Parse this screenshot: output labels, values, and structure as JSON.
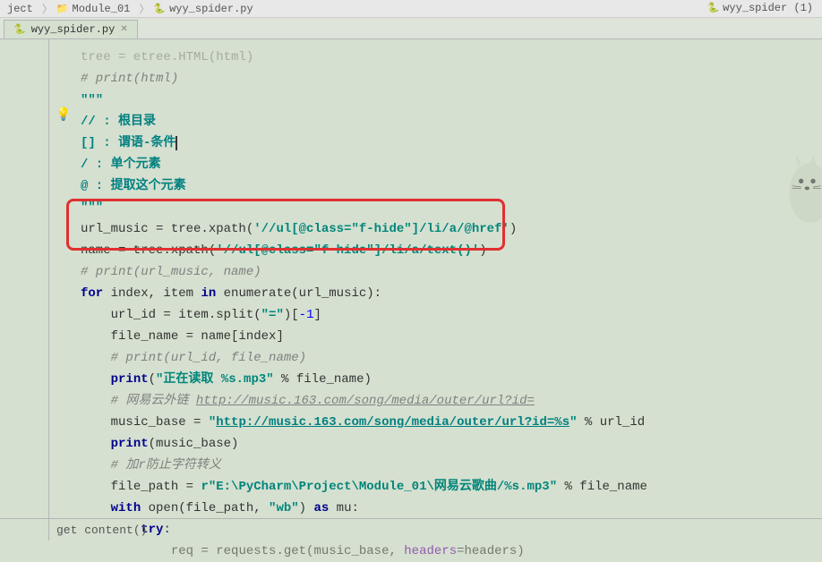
{
  "breadcrumb": {
    "items": [
      {
        "label": "ject"
      },
      {
        "label": "Module_01"
      },
      {
        "label": "wyy_spider.py"
      }
    ]
  },
  "run_config": "wyy_spider (1)",
  "tab": {
    "label": "wyy_spider.py"
  },
  "code": {
    "l1": "tree = etree.HTML(html)",
    "l2": "# print(html)",
    "l3": "\"\"\"",
    "l4": "// : 根目录",
    "l5": "[] : 谓语-条件",
    "l6": "/ : 单个元素",
    "l7": "@ : 提取这个元素",
    "l8": "\"\"\"",
    "l9a": "url_music = tree.xpath(",
    "l9b": "'//ul[@class=\"f-hide\"]/li/a/@href'",
    "l9c": ")",
    "l10a": "name = tree.xpath(",
    "l10b": "'//ul[@class=\"f-hide\"]/li/a/text()'",
    "l10c": ")",
    "l11": "# print(url_music, name)",
    "l12a": "for",
    "l12b": " index, item ",
    "l12c": "in",
    "l12d": " enumerate(url_music):",
    "l13a": "url_id = item.split(",
    "l13b": "\"=\"",
    "l13c": ")[",
    "l13d": "-1",
    "l13e": "]",
    "l14": "file_name = name[index]",
    "l15": "# print(url_id, file_name)",
    "l16a": "print",
    "l16b": "(",
    "l16c": "\"正在读取 %s.mp3\"",
    "l16d": " % file_name)",
    "l17a": "# 网易云外链 ",
    "l17b": "http://music.163.com/song/media/outer/url?id=",
    "l18a": "music_base = ",
    "l18b": "\"",
    "l18c": "http://music.163.com/song/media/outer/url?id=%s",
    "l18d": "\"",
    "l18e": " % url_id",
    "l19a": "print",
    "l19b": "(music_base)",
    "l20": "# 加r防止字符转义",
    "l21a": "file_path = ",
    "l21b": "r\"E:\\PyCharm\\Project\\Module_01\\网易云歌曲/%s.mp3\"",
    "l21c": " % file_name",
    "l22a": "with",
    "l22b": " open(file_path, ",
    "l22c": "\"wb\"",
    "l22d": ") ",
    "l22e": "as",
    "l22f": " mu:",
    "l23a": "try",
    "l23b": ":",
    "l24a": "req = requests.get(music_base, ",
    "l24b": "headers",
    "l24c": "=headers)"
  },
  "status": "get content()"
}
